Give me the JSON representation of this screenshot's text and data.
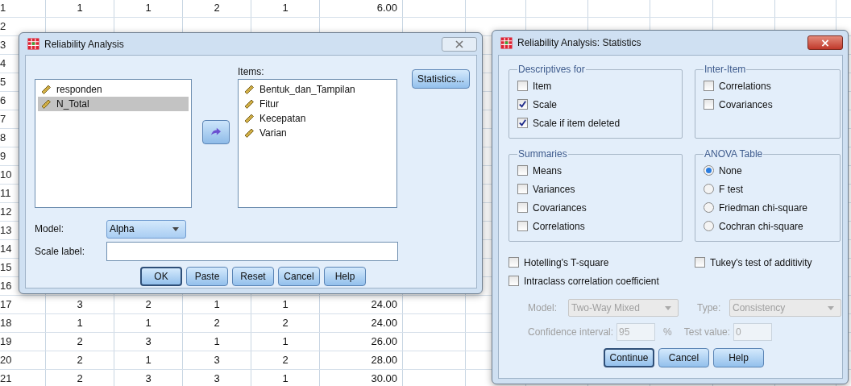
{
  "spreadsheet": {
    "rows": [
      {
        "number": "1",
        "cells": [
          "1",
          "1",
          "2",
          "1",
          "6.00"
        ]
      },
      {
        "number": "2",
        "cells": []
      },
      {
        "number": "3",
        "cells": []
      },
      {
        "number": "4",
        "cells": []
      },
      {
        "number": "5",
        "cells": []
      },
      {
        "number": "6",
        "cells": []
      },
      {
        "number": "7",
        "cells": []
      },
      {
        "number": "8",
        "cells": []
      },
      {
        "number": "9",
        "cells": []
      },
      {
        "number": "10",
        "cells": []
      },
      {
        "number": "11",
        "cells": []
      },
      {
        "number": "12",
        "cells": []
      },
      {
        "number": "13",
        "cells": []
      },
      {
        "number": "14",
        "cells": []
      },
      {
        "number": "15",
        "cells": []
      },
      {
        "number": "16",
        "cells": []
      },
      {
        "number": "17",
        "cells": [
          "3",
          "2",
          "1",
          "1",
          "24.00"
        ]
      },
      {
        "number": "18",
        "cells": [
          "1",
          "1",
          "2",
          "2",
          "24.00"
        ]
      },
      {
        "number": "19",
        "cells": [
          "2",
          "3",
          "1",
          "1",
          "26.00"
        ]
      },
      {
        "number": "20",
        "cells": [
          "2",
          "1",
          "3",
          "2",
          "28.00"
        ]
      },
      {
        "number": "21",
        "cells": [
          "2",
          "3",
          "3",
          "1",
          "30.00"
        ]
      }
    ]
  },
  "reliability_dialog": {
    "title": "Reliability Analysis",
    "variables": [
      {
        "name": "responden",
        "selected": false
      },
      {
        "name": "N_Total",
        "selected": true
      }
    ],
    "items_label": "Items:",
    "items": [
      "Bentuk_dan_Tampilan",
      "Fitur",
      "Kecepatan",
      "Varian"
    ],
    "statistics_button": "Statistics...",
    "model_label": "Model:",
    "model_value": "Alpha",
    "scale_label": "Scale label:",
    "buttons": [
      {
        "label": "OK",
        "default": true
      },
      {
        "label": "Paste",
        "default": false
      },
      {
        "label": "Reset",
        "default": false
      },
      {
        "label": "Cancel",
        "default": false
      },
      {
        "label": "Help",
        "default": false
      }
    ]
  },
  "statistics_dialog": {
    "title": "Reliability Analysis: Statistics",
    "groups": [
      {
        "legend": "Descriptives for",
        "kind": "checkbox",
        "options": [
          {
            "label": "Item",
            "checked": false
          },
          {
            "label": "Scale",
            "checked": true
          },
          {
            "label": "Scale if item deleted",
            "checked": true
          }
        ]
      },
      {
        "legend": "Inter-Item",
        "kind": "checkbox",
        "options": [
          {
            "label": "Correlations",
            "checked": false
          },
          {
            "label": "Covariances",
            "checked": false
          }
        ]
      },
      {
        "legend": "Summaries",
        "kind": "checkbox",
        "options": [
          {
            "label": "Means",
            "checked": false
          },
          {
            "label": "Variances",
            "checked": false
          },
          {
            "label": "Covariances",
            "checked": false
          },
          {
            "label": "Correlations",
            "checked": false
          }
        ]
      },
      {
        "legend": "ANOVA Table",
        "kind": "radio",
        "options": [
          {
            "label": "None",
            "selected": true
          },
          {
            "label": "F test",
            "selected": false
          },
          {
            "label": "Friedman chi-square",
            "selected": false
          },
          {
            "label": "Cochran chi-square",
            "selected": false
          }
        ]
      }
    ],
    "extra_options": [
      {
        "label": "Hotelling's T-square",
        "checked": false
      },
      {
        "label": "Tukey's test of additivity",
        "checked": false
      },
      {
        "label": "Intraclass correlation coefficient",
        "checked": false
      }
    ],
    "icc": {
      "disabled": true,
      "model_label": "Model:",
      "model_value": "Two-Way Mixed",
      "type_label": "Type:",
      "type_value": "Consistency",
      "confidence_label": "Confidence interval:",
      "confidence_value": "95",
      "percent": "%",
      "test_value_label": "Test value:",
      "test_value": "0"
    },
    "buttons": [
      {
        "label": "Continue",
        "default": true
      },
      {
        "label": "Cancel",
        "default": false
      },
      {
        "label": "Help",
        "default": false
      }
    ]
  }
}
